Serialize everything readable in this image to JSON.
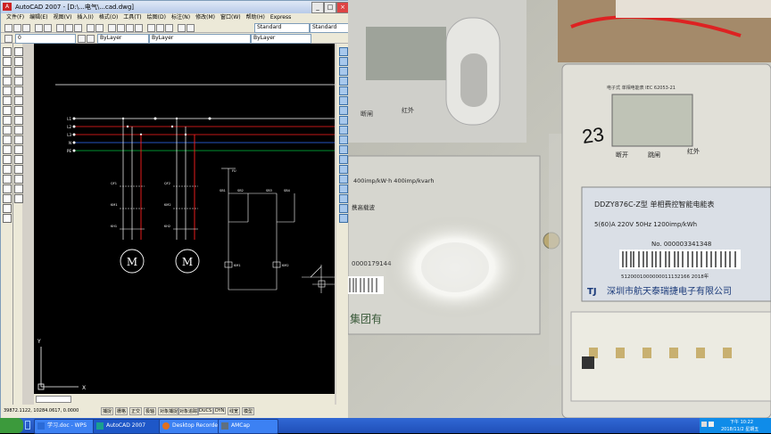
{
  "window": {
    "title": "AutoCAD 2007 - [D:\\...电气\\...cad.dwg]",
    "minimize": "_",
    "maximize": "□",
    "close": "×"
  },
  "menu": [
    "文件(F)",
    "编辑(E)",
    "视图(V)",
    "插入(I)",
    "格式(O)",
    "工具(T)",
    "绘图(D)",
    "标注(N)",
    "修改(M)",
    "窗口(W)",
    "帮助(H)",
    "Express"
  ],
  "toolbars": {
    "style_select": "Standard",
    "layer_select": "0",
    "color_select": "ByLayer",
    "linetype_select": "ByLayer"
  },
  "drawing": {
    "bus_labels": [
      "L1",
      "L2",
      "L3",
      "N",
      "PE"
    ],
    "motor_label": "M",
    "component_labels": {
      "qf1": "QF1",
      "km1": "KM1",
      "kh1": "KH1",
      "qf2": "QF2",
      "km2": "KM2",
      "kh2": "KH2",
      "fu": "FU",
      "sb1": "SB1",
      "sb2": "SB2",
      "sb3": "SB3",
      "sb4": "SB4",
      "km1_coil": "KM1",
      "km2_coil": "KM2"
    },
    "ucs_x": "X",
    "ucs_y": "Y"
  },
  "status": {
    "coords": "39872.1122, 10284.0617, 0.0000",
    "toggles": [
      "捕捉",
      "栅格",
      "正交",
      "极轴",
      "对象捕捉",
      "对象追踪",
      "DUCS",
      "DYN",
      "线宽",
      "模型"
    ]
  },
  "taskbar": {
    "items": [
      {
        "label": "学习.doc - WPS",
        "icon": "wps-writer-icon",
        "color": "#2b6bd7"
      },
      {
        "label": "AutoCAD 2007",
        "icon": "autocad-icon",
        "color": "#1a9f8f"
      },
      {
        "label": "Desktop Recorder",
        "icon": "recorder-icon",
        "color": "#e07020"
      },
      {
        "label": "AMCap",
        "icon": "amcap-icon",
        "color": "#607080"
      }
    ],
    "time": "下午 10:22",
    "date": "2018/11/2 星期五"
  },
  "photo": {
    "meter_left_rate": "400imp/kW·h  400imp/kvarh",
    "meter_left_serial": "0000179144",
    "meter_left_maker": "集团有",
    "meter_left_label": "携高载波",
    "meter_right_top": "电子式 单相电能表 IEC 62053-21",
    "meter_right_buttons": [
      "断开",
      "跳闸",
      "红外"
    ],
    "meter_right_model": "DDZY876C-Z型   单相费控智能电能表",
    "meter_right_spec": "5(60)A  220V  50Hz  1200imp/kWh",
    "meter_right_serial": "No. 000003341348",
    "meter_right_barcode_num": "5120001000000011132166  2018年",
    "meter_right_maker": "深圳市航天泰瑞捷电子有限公司",
    "meter_right_logo": "TJ",
    "handwritten": "23",
    "meter_left_top_buttons": [
      "断闸",
      "红外"
    ]
  },
  "colors": {
    "autocad_bg": "#000000",
    "xp_taskbar": "#245edb",
    "bus_colors": [
      "#ffffff",
      "#ff2020",
      "#ff2020",
      "#2060ff",
      "#00c040"
    ]
  }
}
